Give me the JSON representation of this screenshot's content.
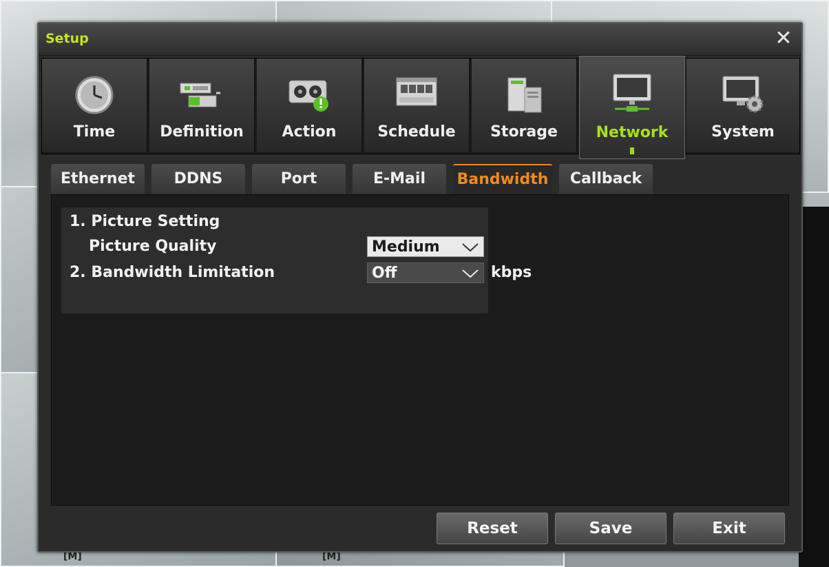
{
  "window": {
    "title": "Setup",
    "close_icon": "close-icon"
  },
  "categories": [
    {
      "label": "Time",
      "icon": "clock-icon",
      "active": false
    },
    {
      "label": "Definition",
      "icon": "camera-device-icon",
      "active": false
    },
    {
      "label": "Action",
      "icon": "alarm-action-icon",
      "active": false
    },
    {
      "label": "Schedule",
      "icon": "schedule-icon",
      "active": false
    },
    {
      "label": "Storage",
      "icon": "storage-icon",
      "active": false
    },
    {
      "label": "Network",
      "icon": "network-monitor-icon",
      "active": true
    },
    {
      "label": "System",
      "icon": "system-settings-icon",
      "active": false
    }
  ],
  "subtabs": [
    {
      "label": "Ethernet",
      "active": false
    },
    {
      "label": "DDNS",
      "active": false
    },
    {
      "label": "Port",
      "active": false
    },
    {
      "label": "E-Mail",
      "active": false
    },
    {
      "label": "Bandwidth",
      "active": true
    },
    {
      "label": "Callback",
      "active": false
    }
  ],
  "content": {
    "picture_setting_label": "1. Picture Setting",
    "picture_quality_label": "Picture Quality",
    "picture_quality_value": "Medium",
    "bandwidth_limitation_label": "2. Bandwidth Limitation",
    "bandwidth_limitation_value": "Off",
    "bandwidth_unit": "kbps"
  },
  "buttons": {
    "reset": "Reset",
    "save": "Save",
    "exit": "Exit"
  },
  "colors": {
    "title": "#c6e21a",
    "active_category": "#a7e11e",
    "active_subtab": "#f08a1e"
  }
}
